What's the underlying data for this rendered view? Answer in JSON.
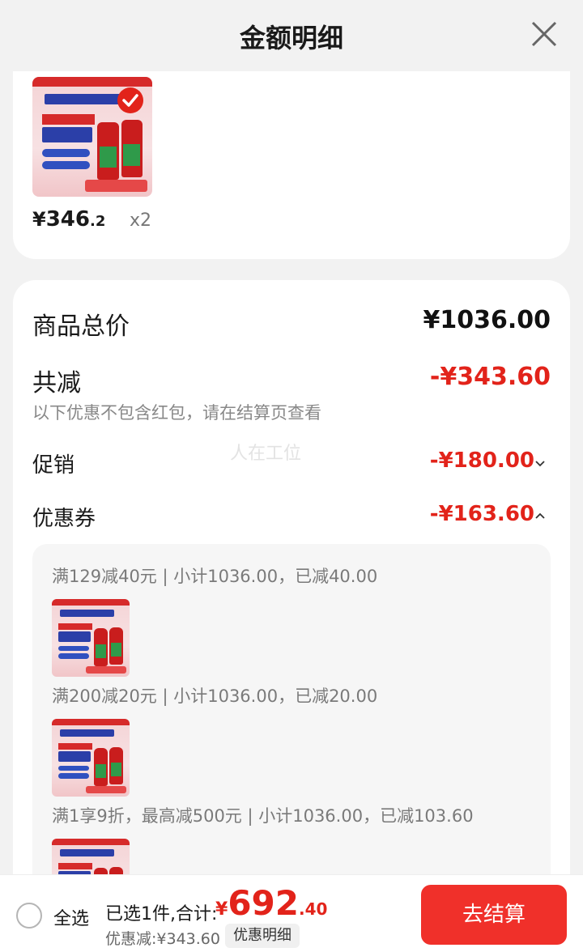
{
  "header": {
    "title": "金额明细"
  },
  "product": {
    "price_yen": "¥",
    "price_int": "346",
    "price_dec": ".2",
    "quantity": "x2"
  },
  "summary": {
    "total_label": "商品总价",
    "total_value": "¥1036.00",
    "reduce_label": "共减",
    "reduce_value": "-¥343.60",
    "note": "以下优惠不包含红包，请在结算页查看",
    "watermark": "人在工位",
    "promo_label": "促销",
    "promo_value": "-¥180.00",
    "coupon_label": "优惠券",
    "coupon_value": "-¥163.60"
  },
  "coupons": [
    {
      "text": "满129减40元 | 小计1036.00，已减40.00"
    },
    {
      "text": "满200减20元 | 小计1036.00，已减20.00"
    },
    {
      "text": "满1享9折，最高减500元 | 小计1036.00，已减103.60"
    }
  ],
  "bottom": {
    "select_all": "全选",
    "selected_text": "已选1件,合计:",
    "total_yen": "¥",
    "total_int": "692",
    "total_dec": ".40",
    "discount_text": "优惠减:¥343.60",
    "detail_button": "优惠明细",
    "checkout_button": "去结算"
  },
  "colors": {
    "accent": "#e2231a",
    "checkout": "#f0302a"
  }
}
